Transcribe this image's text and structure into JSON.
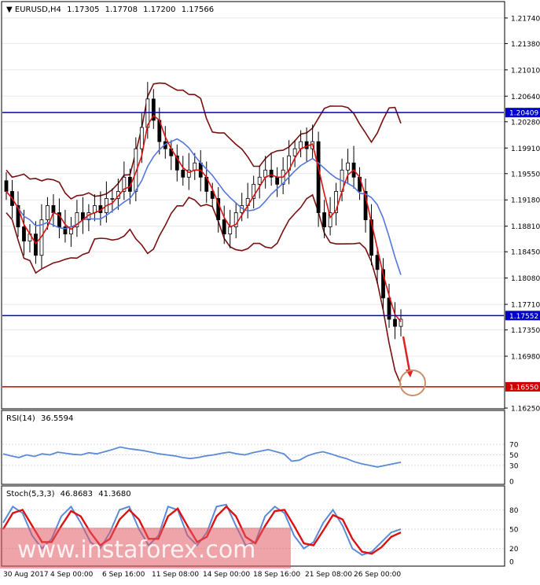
{
  "chart_data": [
    {
      "type": "candlestick",
      "panel": "main",
      "header_symbol": "EURUSD,H4",
      "header_ohlc": [
        "1.17305",
        "1.17708",
        "1.17200",
        "1.17566"
      ],
      "ylim": [
        1.1625,
        1.2196
      ],
      "y_ticks": [
        "1.21740",
        "1.21380",
        "1.21010",
        "1.20640",
        "1.20280",
        "1.19910",
        "1.19550",
        "1.19180",
        "1.18810",
        "1.18450",
        "1.18080",
        "1.17710",
        "1.17350",
        "1.16980",
        "1.16250"
      ],
      "levels": [
        {
          "value": 1.20409,
          "label": "1.20409",
          "color": "#0000cc"
        },
        {
          "value": 1.17552,
          "label": "1.17552",
          "color": "#0000cc"
        },
        {
          "value": 1.1655,
          "label": "1.16550",
          "color": "#cc0000"
        }
      ],
      "close_approx": [
        1.193,
        1.191,
        1.188,
        1.186,
        1.187,
        1.184,
        1.189,
        1.191,
        1.19,
        1.188,
        1.187,
        1.188,
        1.19,
        1.189,
        1.19,
        1.191,
        1.19,
        1.192,
        1.192,
        1.193,
        1.195,
        1.193,
        1.199,
        1.202,
        1.206,
        1.203,
        1.2,
        1.199,
        1.198,
        1.196,
        1.195,
        1.196,
        1.197,
        1.195,
        1.193,
        1.192,
        1.189,
        1.187,
        1.188,
        1.19,
        1.191,
        1.192,
        1.194,
        1.195,
        1.196,
        1.195,
        1.194,
        1.196,
        1.198,
        1.199,
        1.2,
        1.199,
        1.2,
        1.19,
        1.188,
        1.19,
        1.193,
        1.196,
        1.197,
        1.195,
        1.193,
        1.189,
        1.184,
        1.182,
        1.178,
        1.175,
        1.174,
        1.175
      ]
    },
    {
      "type": "line",
      "panel": "rsi",
      "label": "RSI(14)",
      "value": "36.5594",
      "y_ticks": [
        "70",
        "50",
        "30",
        "0"
      ],
      "ylim": [
        0,
        100
      ],
      "values": [
        52,
        48,
        45,
        50,
        47,
        52,
        50,
        55,
        53,
        51,
        50,
        54,
        52,
        56,
        60,
        65,
        62,
        60,
        58,
        55,
        52,
        50,
        48,
        45,
        43,
        45,
        48,
        50,
        53,
        55,
        52,
        50,
        54,
        57,
        60,
        56,
        52,
        38,
        40,
        48,
        53,
        56,
        52,
        47,
        43,
        37,
        33,
        30,
        27,
        30,
        33,
        36
      ]
    },
    {
      "type": "line",
      "panel": "stochastic",
      "label": "Stoch(5,3,3)",
      "values_text": [
        "46.8683",
        "41.3680"
      ],
      "y_ticks": [
        "80",
        "50",
        "20",
        "0"
      ],
      "ylim": [
        0,
        100
      ],
      "series": [
        {
          "values": [
            60,
            85,
            75,
            40,
            20,
            35,
            70,
            85,
            60,
            30,
            20,
            45,
            80,
            85,
            50,
            25,
            40,
            85,
            80,
            40,
            25,
            45,
            85,
            88,
            55,
            25,
            30,
            70,
            85,
            75,
            40,
            20,
            30,
            60,
            80,
            55,
            20,
            10,
            15,
            30,
            45,
            50
          ]
        },
        {
          "values": [
            50,
            75,
            80,
            55,
            30,
            30,
            55,
            78,
            70,
            45,
            25,
            35,
            65,
            80,
            65,
            35,
            35,
            70,
            82,
            55,
            30,
            38,
            70,
            85,
            70,
            38,
            28,
            55,
            78,
            80,
            55,
            28,
            25,
            48,
            72,
            65,
            35,
            15,
            12,
            22,
            38,
            45
          ]
        }
      ]
    }
  ],
  "x_labels": [
    "30 Aug 2017",
    "4 Sep 00:00",
    "6 Sep 16:00",
    "11 Sep 08:00",
    "14 Sep 00:00",
    "18 Sep 16:00",
    "21 Sep 08:00",
    "26 Sep 00:00"
  ],
  "watermark": "www.instaforex.com"
}
